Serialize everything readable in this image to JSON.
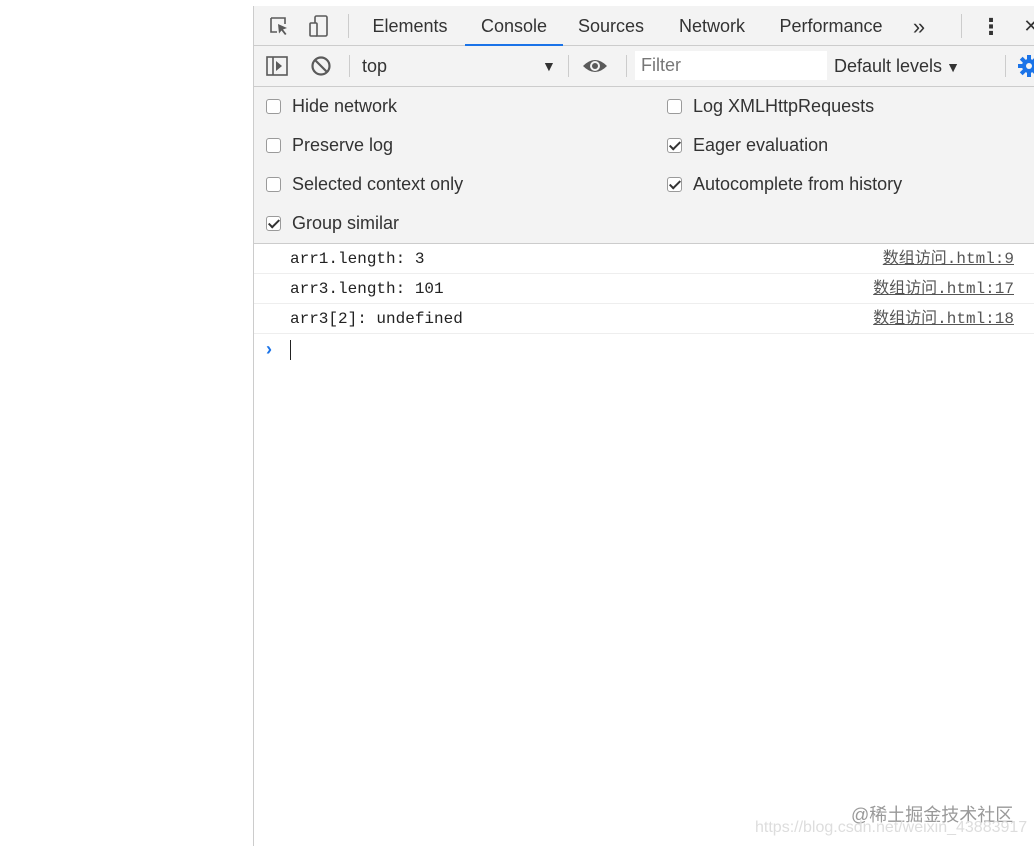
{
  "tabs": [
    {
      "label": "Elements"
    },
    {
      "label": "Console"
    },
    {
      "label": "Sources"
    },
    {
      "label": "Network"
    },
    {
      "label": "Performance"
    }
  ],
  "tabbar": {
    "more_tabs_glyph": "»",
    "menu_glyph": "⋮",
    "close_glyph": "✕"
  },
  "toolbar": {
    "context_value": "top",
    "filter_placeholder": "Filter",
    "levels_label": "Default levels",
    "dropdown_glyph": "▼"
  },
  "settings": [
    {
      "label": "Hide network",
      "checked": false
    },
    {
      "label": "Log XMLHttpRequests",
      "checked": false
    },
    {
      "label": "Preserve log",
      "checked": false
    },
    {
      "label": "Eager evaluation",
      "checked": true
    },
    {
      "label": "Selected context only",
      "checked": false
    },
    {
      "label": "Autocomplete from history",
      "checked": true
    },
    {
      "label": "Group similar",
      "checked": true
    }
  ],
  "messages": [
    {
      "text": "arr1.length: 3",
      "source": "数组访问.html:9"
    },
    {
      "text": "arr3.length: 101",
      "source": "数组访问.html:17"
    },
    {
      "text": "arr3[2]: undefined",
      "source": "数组访问.html:18"
    }
  ],
  "prompt_glyph": "›",
  "watermark": {
    "line1": "@稀土掘金技术社区",
    "line2": "https://blog.csdn.net/weixin_43883917"
  },
  "colors": {
    "accent": "#1a73e8",
    "toolbar_bg": "#f3f3f3",
    "border": "#cccccc"
  },
  "icons": {
    "inspect": "inspect-element-icon",
    "device": "device-toolbar-icon",
    "sidebar": "show-sidebar-icon",
    "clear": "clear-console-icon",
    "eye": "live-expression-icon",
    "gear": "settings-gear-icon"
  }
}
